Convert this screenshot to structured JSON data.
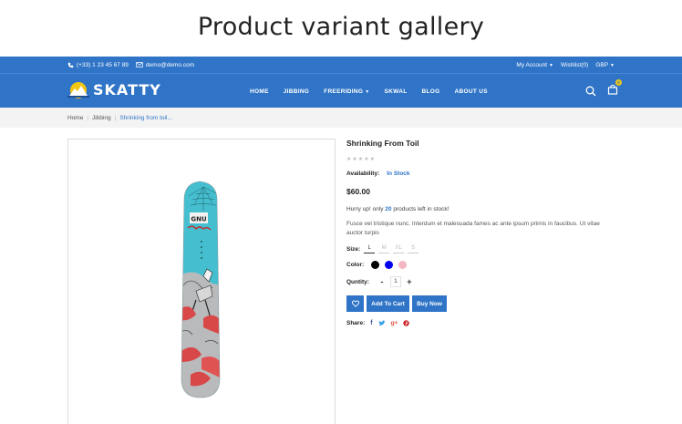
{
  "headline": "Product variant gallery",
  "topbar": {
    "phone": "(+33) 1 23 45 67 89",
    "email": "demo@demo.com",
    "account": "My Account",
    "wishlist": "Wishlist(0)",
    "currency": "GBP"
  },
  "brand": {
    "name": "SKATTY"
  },
  "menu": [
    {
      "label": "HOME"
    },
    {
      "label": "JIBBING"
    },
    {
      "label": "FREERIDING"
    },
    {
      "label": "SKWAL"
    },
    {
      "label": "BLOG"
    },
    {
      "label": "ABOUT US"
    }
  ],
  "cart": {
    "count": "0"
  },
  "breadcrumb": [
    "Home",
    "Jibbing",
    "Shrinking from toil..."
  ],
  "product": {
    "title": "Shrinking From Toil",
    "rating": 0,
    "availability_label": "Availability:",
    "availability_value": "In Stock",
    "price": "$60.00",
    "hurry_prefix": "Hurry up! only",
    "hurry_count": "20",
    "hurry_suffix": "products left in stock!",
    "description": "Fusce vel tristique nunc. Interdum et malesuada fames ac ante ipsum primis in faucibus. Ut vitae auctor turpis",
    "size_label": "Size:",
    "sizes": [
      "L",
      "M",
      "XL",
      "S"
    ],
    "selected_size": "L",
    "color_label": "Color:",
    "colors": [
      "#000000",
      "#0000ee",
      "#f4b6c2"
    ],
    "quantity_label": "Quntity:",
    "quantity": "1",
    "add_to_cart": "Add To Cart",
    "buy_now": "Buy Now",
    "share_label": "Share:"
  },
  "colors": {
    "primary": "#2f74c7",
    "badge": "#f3c614",
    "pinterest": "#cb2027",
    "googleplus": "#dd4b39"
  }
}
